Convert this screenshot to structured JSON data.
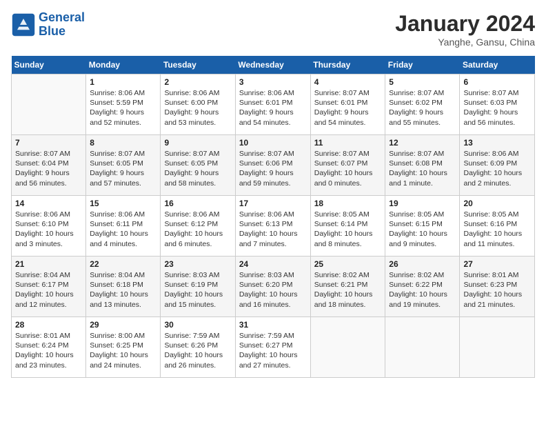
{
  "header": {
    "logo_line1": "General",
    "logo_line2": "Blue",
    "month": "January 2024",
    "location": "Yanghe, Gansu, China"
  },
  "weekdays": [
    "Sunday",
    "Monday",
    "Tuesday",
    "Wednesday",
    "Thursday",
    "Friday",
    "Saturday"
  ],
  "weeks": [
    [
      {
        "day": "",
        "sunrise": "",
        "sunset": "",
        "daylight": ""
      },
      {
        "day": "1",
        "sunrise": "Sunrise: 8:06 AM",
        "sunset": "Sunset: 5:59 PM",
        "daylight": "Daylight: 9 hours and 52 minutes."
      },
      {
        "day": "2",
        "sunrise": "Sunrise: 8:06 AM",
        "sunset": "Sunset: 6:00 PM",
        "daylight": "Daylight: 9 hours and 53 minutes."
      },
      {
        "day": "3",
        "sunrise": "Sunrise: 8:06 AM",
        "sunset": "Sunset: 6:01 PM",
        "daylight": "Daylight: 9 hours and 54 minutes."
      },
      {
        "day": "4",
        "sunrise": "Sunrise: 8:07 AM",
        "sunset": "Sunset: 6:01 PM",
        "daylight": "Daylight: 9 hours and 54 minutes."
      },
      {
        "day": "5",
        "sunrise": "Sunrise: 8:07 AM",
        "sunset": "Sunset: 6:02 PM",
        "daylight": "Daylight: 9 hours and 55 minutes."
      },
      {
        "day": "6",
        "sunrise": "Sunrise: 8:07 AM",
        "sunset": "Sunset: 6:03 PM",
        "daylight": "Daylight: 9 hours and 56 minutes."
      }
    ],
    [
      {
        "day": "7",
        "sunrise": "Sunrise: 8:07 AM",
        "sunset": "Sunset: 6:04 PM",
        "daylight": "Daylight: 9 hours and 56 minutes."
      },
      {
        "day": "8",
        "sunrise": "Sunrise: 8:07 AM",
        "sunset": "Sunset: 6:05 PM",
        "daylight": "Daylight: 9 hours and 57 minutes."
      },
      {
        "day": "9",
        "sunrise": "Sunrise: 8:07 AM",
        "sunset": "Sunset: 6:05 PM",
        "daylight": "Daylight: 9 hours and 58 minutes."
      },
      {
        "day": "10",
        "sunrise": "Sunrise: 8:07 AM",
        "sunset": "Sunset: 6:06 PM",
        "daylight": "Daylight: 9 hours and 59 minutes."
      },
      {
        "day": "11",
        "sunrise": "Sunrise: 8:07 AM",
        "sunset": "Sunset: 6:07 PM",
        "daylight": "Daylight: 10 hours and 0 minutes."
      },
      {
        "day": "12",
        "sunrise": "Sunrise: 8:07 AM",
        "sunset": "Sunset: 6:08 PM",
        "daylight": "Daylight: 10 hours and 1 minute."
      },
      {
        "day": "13",
        "sunrise": "Sunrise: 8:06 AM",
        "sunset": "Sunset: 6:09 PM",
        "daylight": "Daylight: 10 hours and 2 minutes."
      }
    ],
    [
      {
        "day": "14",
        "sunrise": "Sunrise: 8:06 AM",
        "sunset": "Sunset: 6:10 PM",
        "daylight": "Daylight: 10 hours and 3 minutes."
      },
      {
        "day": "15",
        "sunrise": "Sunrise: 8:06 AM",
        "sunset": "Sunset: 6:11 PM",
        "daylight": "Daylight: 10 hours and 4 minutes."
      },
      {
        "day": "16",
        "sunrise": "Sunrise: 8:06 AM",
        "sunset": "Sunset: 6:12 PM",
        "daylight": "Daylight: 10 hours and 6 minutes."
      },
      {
        "day": "17",
        "sunrise": "Sunrise: 8:06 AM",
        "sunset": "Sunset: 6:13 PM",
        "daylight": "Daylight: 10 hours and 7 minutes."
      },
      {
        "day": "18",
        "sunrise": "Sunrise: 8:05 AM",
        "sunset": "Sunset: 6:14 PM",
        "daylight": "Daylight: 10 hours and 8 minutes."
      },
      {
        "day": "19",
        "sunrise": "Sunrise: 8:05 AM",
        "sunset": "Sunset: 6:15 PM",
        "daylight": "Daylight: 10 hours and 9 minutes."
      },
      {
        "day": "20",
        "sunrise": "Sunrise: 8:05 AM",
        "sunset": "Sunset: 6:16 PM",
        "daylight": "Daylight: 10 hours and 11 minutes."
      }
    ],
    [
      {
        "day": "21",
        "sunrise": "Sunrise: 8:04 AM",
        "sunset": "Sunset: 6:17 PM",
        "daylight": "Daylight: 10 hours and 12 minutes."
      },
      {
        "day": "22",
        "sunrise": "Sunrise: 8:04 AM",
        "sunset": "Sunset: 6:18 PM",
        "daylight": "Daylight: 10 hours and 13 minutes."
      },
      {
        "day": "23",
        "sunrise": "Sunrise: 8:03 AM",
        "sunset": "Sunset: 6:19 PM",
        "daylight": "Daylight: 10 hours and 15 minutes."
      },
      {
        "day": "24",
        "sunrise": "Sunrise: 8:03 AM",
        "sunset": "Sunset: 6:20 PM",
        "daylight": "Daylight: 10 hours and 16 minutes."
      },
      {
        "day": "25",
        "sunrise": "Sunrise: 8:02 AM",
        "sunset": "Sunset: 6:21 PM",
        "daylight": "Daylight: 10 hours and 18 minutes."
      },
      {
        "day": "26",
        "sunrise": "Sunrise: 8:02 AM",
        "sunset": "Sunset: 6:22 PM",
        "daylight": "Daylight: 10 hours and 19 minutes."
      },
      {
        "day": "27",
        "sunrise": "Sunrise: 8:01 AM",
        "sunset": "Sunset: 6:23 PM",
        "daylight": "Daylight: 10 hours and 21 minutes."
      }
    ],
    [
      {
        "day": "28",
        "sunrise": "Sunrise: 8:01 AM",
        "sunset": "Sunset: 6:24 PM",
        "daylight": "Daylight: 10 hours and 23 minutes."
      },
      {
        "day": "29",
        "sunrise": "Sunrise: 8:00 AM",
        "sunset": "Sunset: 6:25 PM",
        "daylight": "Daylight: 10 hours and 24 minutes."
      },
      {
        "day": "30",
        "sunrise": "Sunrise: 7:59 AM",
        "sunset": "Sunset: 6:26 PM",
        "daylight": "Daylight: 10 hours and 26 minutes."
      },
      {
        "day": "31",
        "sunrise": "Sunrise: 7:59 AM",
        "sunset": "Sunset: 6:27 PM",
        "daylight": "Daylight: 10 hours and 27 minutes."
      },
      {
        "day": "",
        "sunrise": "",
        "sunset": "",
        "daylight": ""
      },
      {
        "day": "",
        "sunrise": "",
        "sunset": "",
        "daylight": ""
      },
      {
        "day": "",
        "sunrise": "",
        "sunset": "",
        "daylight": ""
      }
    ]
  ]
}
